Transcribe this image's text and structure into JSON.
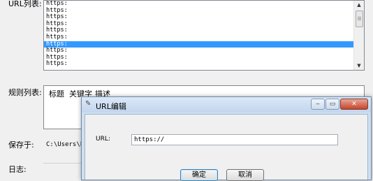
{
  "main": {
    "url_list_label": "URL列表:",
    "url_rows": [
      "https:",
      "https:",
      "https:",
      "https:",
      "https:",
      "https:",
      "https:",
      "https:",
      "https:",
      "https:"
    ],
    "selected_row_index": 6,
    "rules_label": "规则列表:",
    "rule_headers": [
      "标题",
      "关键字",
      "描述"
    ],
    "save_label": "保存于:",
    "save_path": "C:\\Users\\PC",
    "log_label": "日志:"
  },
  "dialog": {
    "title": "URL编辑",
    "url_label": "URL:",
    "url_value": "https://",
    "ok_label": "确定",
    "cancel_label": "取消"
  }
}
